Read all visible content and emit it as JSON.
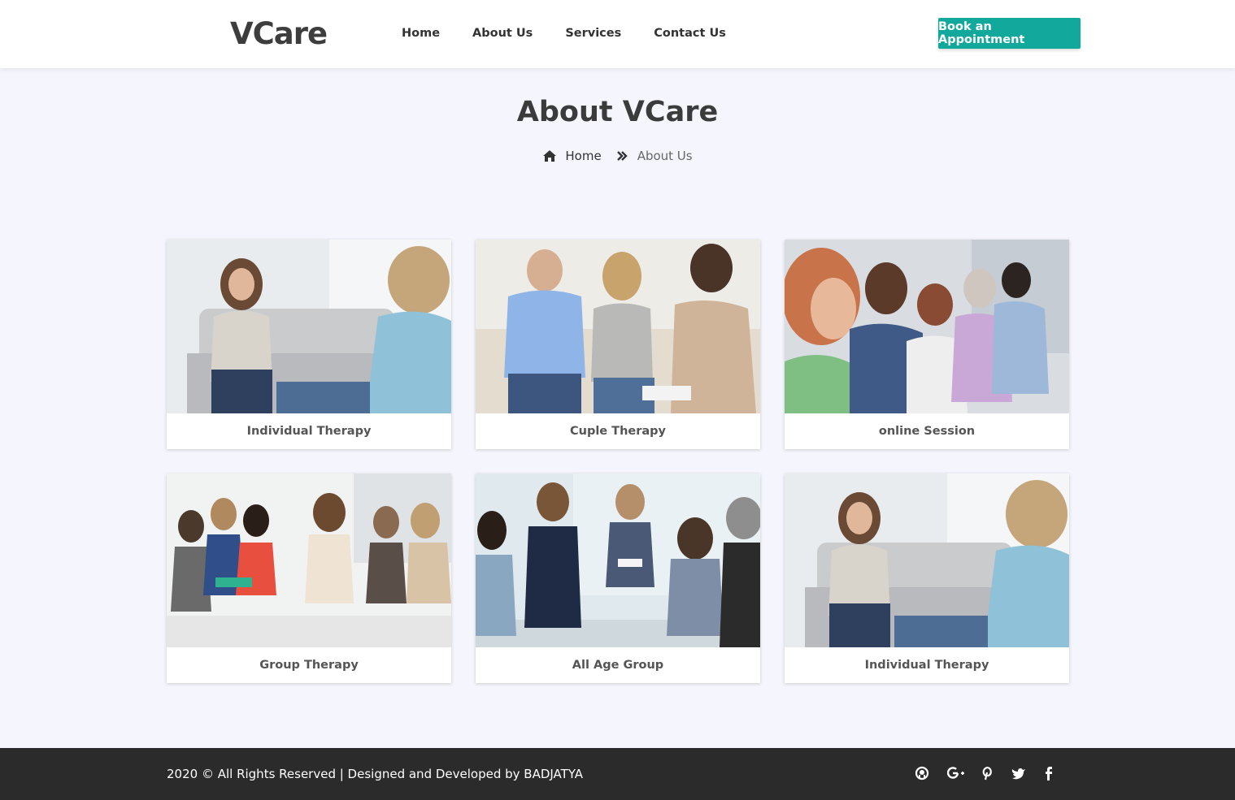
{
  "header": {
    "logo": "VCare",
    "nav": [
      "Home",
      "About Us",
      "Services",
      "Contact Us"
    ],
    "cta_label": "Book an Appointment"
  },
  "hero": {
    "title": "About VCare",
    "breadcrumb": {
      "home": "Home",
      "current": "About Us"
    }
  },
  "cards": [
    {
      "caption": "Individual Therapy"
    },
    {
      "caption": "Cuple Therapy"
    },
    {
      "caption": "online Session"
    },
    {
      "caption": "Group Therapy"
    },
    {
      "caption": "All Age Group"
    },
    {
      "caption": "Individual Therapy"
    }
  ],
  "footer": {
    "copyright": "2020 © All Rights Reserved | Designed and Developed by BADJATYA",
    "social": [
      "github-icon",
      "google-plus-icon",
      "pinterest-icon",
      "twitter-icon",
      "facebook-icon"
    ]
  },
  "colors": {
    "accent": "#12a89c",
    "footer_bg": "#2b2b2b",
    "page_bg": "#f5f6fd"
  }
}
